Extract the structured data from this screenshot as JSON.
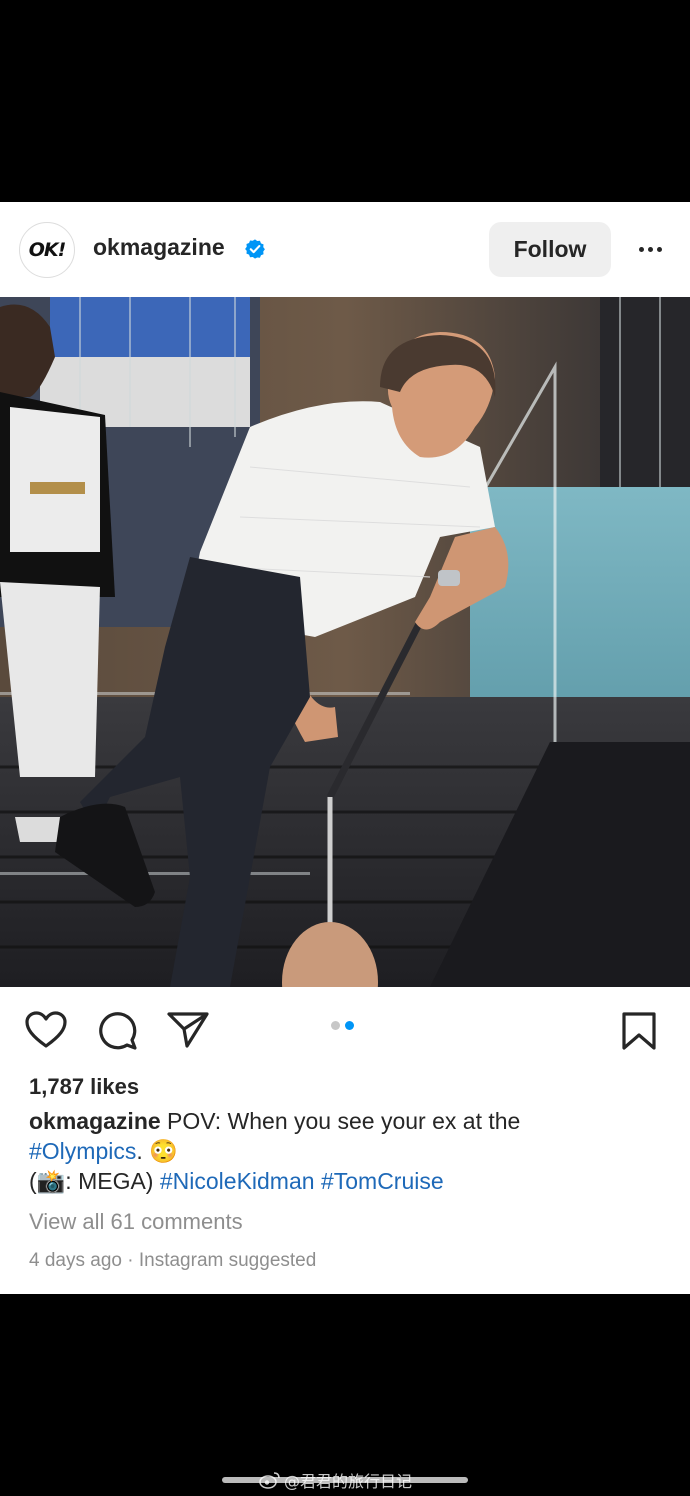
{
  "post": {
    "username": "okmagazine",
    "avatar_text": "OK!",
    "verified": true,
    "follow_label": "Follow",
    "more_icon": "more-dots-icon",
    "carousel": {
      "count": 2,
      "active_index": 1
    },
    "likes": "1,787 likes",
    "caption": {
      "username": "okmagazine",
      "text_1": "POV: When you see your ex at the",
      "hashtag_1": "#Olympics",
      "text_2": ". 😳",
      "line_2_start": " (📸: MEGA)",
      "hashtag_2": "#NicoleKidman",
      "hashtag_3": "#TomCruise"
    },
    "comments_link": "View all 61 comments",
    "timestamp": "4 days ago",
    "separator": "·",
    "suggested": "Instagram suggested"
  },
  "watermark": "@君君的旅行日记",
  "colors": {
    "verified_blue": "#0095f6",
    "hashtag_blue": "#1e69b8",
    "muted_gray": "#8e8e8e",
    "text_dark": "#262626",
    "dot_active": "#0095f6",
    "dot_inactive": "#c7c7c7"
  }
}
